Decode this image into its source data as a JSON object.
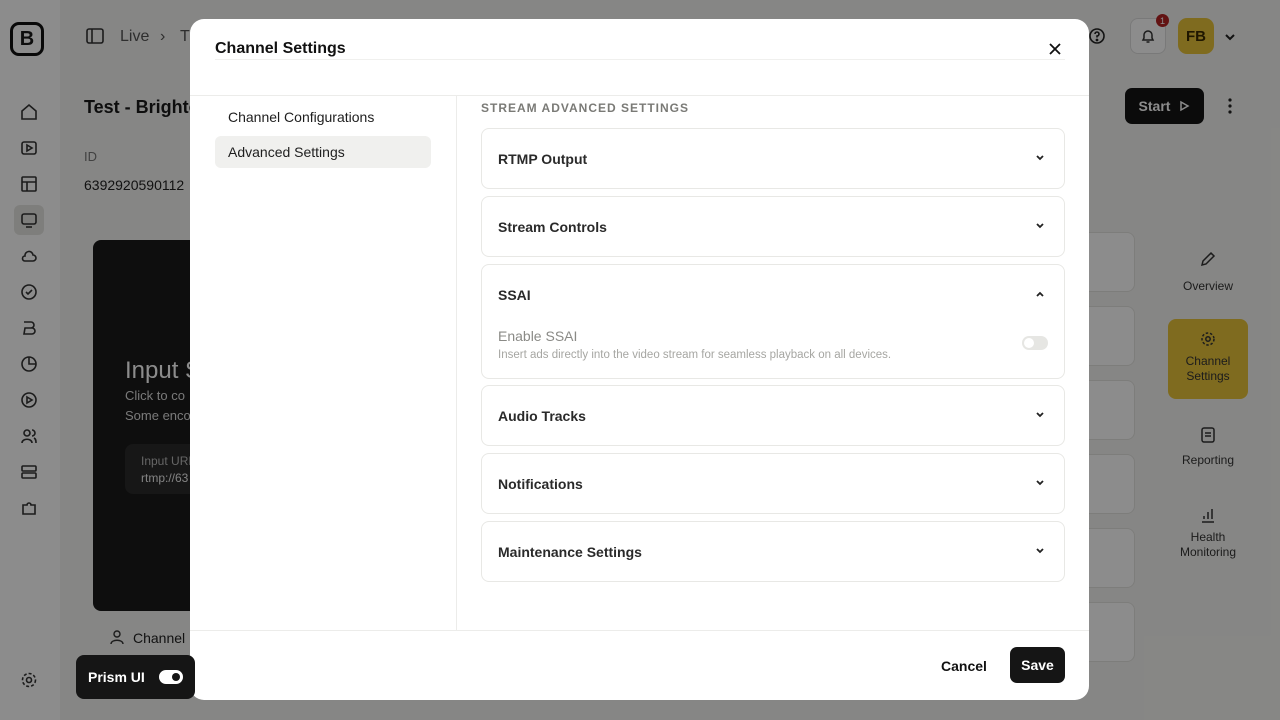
{
  "app": {
    "logo_letter": "B",
    "breadcrumb": [
      "Live",
      "T"
    ],
    "page_title": "Test - Brighto",
    "id_label": "ID",
    "id_value": "6392920590112",
    "avatar_initials": "FB",
    "notification_count": "1",
    "start_label": "Start",
    "video": {
      "title": "Input S",
      "line1": "Click to co",
      "line2": "Some enco",
      "url_label": "Input URL",
      "url_value": "rtmp://63"
    },
    "channel_label": "Channel",
    "right_nav": [
      {
        "label": "Overview",
        "icon": "pencil-icon"
      },
      {
        "label": "Channel Settings",
        "icon": "gear-icon"
      },
      {
        "label": "Reporting",
        "icon": "document-icon"
      },
      {
        "label": "Health Monitoring",
        "icon": "bar-chart-icon"
      }
    ],
    "accent_color": "#e8c33a"
  },
  "modal": {
    "title": "Channel Settings",
    "nav": [
      {
        "label": "Channel Configurations",
        "active": false
      },
      {
        "label": "Advanced Settings",
        "active": true
      }
    ],
    "section_heading": "STREAM ADVANCED SETTINGS",
    "accordions": [
      {
        "label": "RTMP Output",
        "expanded": false
      },
      {
        "label": "Stream Controls",
        "expanded": false
      },
      {
        "label": "SSAI",
        "expanded": true
      },
      {
        "label": "Audio Tracks",
        "expanded": false
      },
      {
        "label": "Notifications",
        "expanded": false
      },
      {
        "label": "Maintenance Settings",
        "expanded": false
      }
    ],
    "ssai": {
      "toggle_label": "Enable SSAI",
      "toggle_description": "Insert ads directly into the video stream for seamless playback on all devices.",
      "enabled": false
    },
    "cancel_label": "Cancel",
    "save_label": "Save"
  },
  "prism": {
    "label": "Prism UI",
    "enabled": true
  }
}
